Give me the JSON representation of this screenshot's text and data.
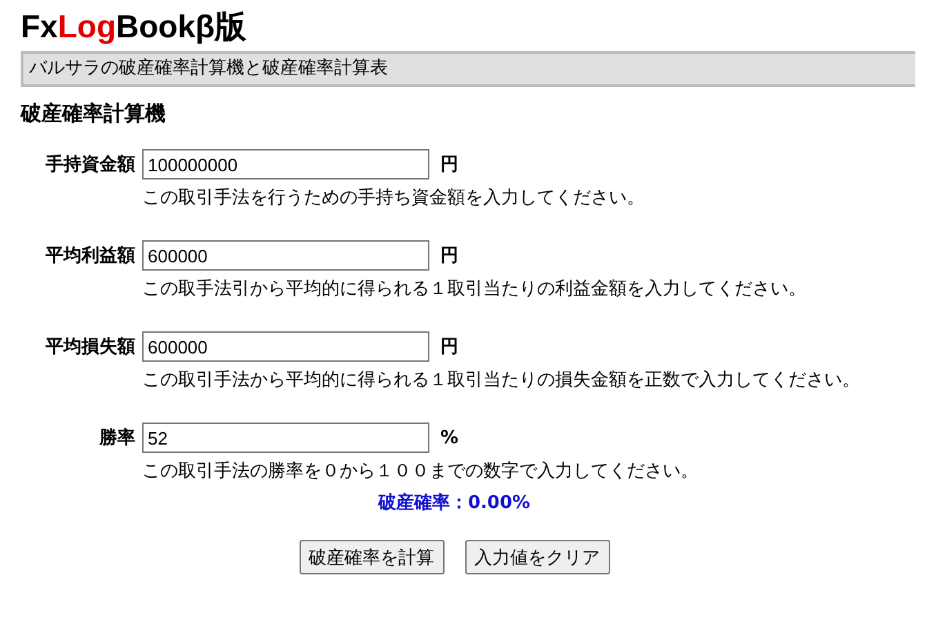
{
  "logo": {
    "parts": [
      {
        "text": "Fx",
        "highlighted": false
      },
      {
        "text": "Log",
        "highlighted": true
      },
      {
        "text": "Bookβ版",
        "highlighted": false
      }
    ]
  },
  "banner": "バルサラの破産確率計算機と破産確率計算表",
  "section_title": "破産確率計算機",
  "fields": [
    {
      "label": "手持資金額",
      "value": "100000000",
      "unit": "円",
      "hint": "この取引手法を行うための手持ち資金額を入力してください。"
    },
    {
      "label": "平均利益額",
      "value": "600000",
      "unit": "円",
      "hint": "この取手法引から平均的に得られる１取引当たりの利益金額を入力してください。"
    },
    {
      "label": "平均損失額",
      "value": "600000",
      "unit": "円",
      "hint": "この取引手法から平均的に得られる１取引当たりの損失金額を正数で入力してください。"
    },
    {
      "label": "勝率",
      "value": "52",
      "unit": "%",
      "hint": "この取引手法の勝率を０から１００までの数字で入力してください。"
    }
  ],
  "result": "破産確率：0.00%",
  "buttons": [
    "破産確率を計算",
    "入力値をクリア"
  ]
}
